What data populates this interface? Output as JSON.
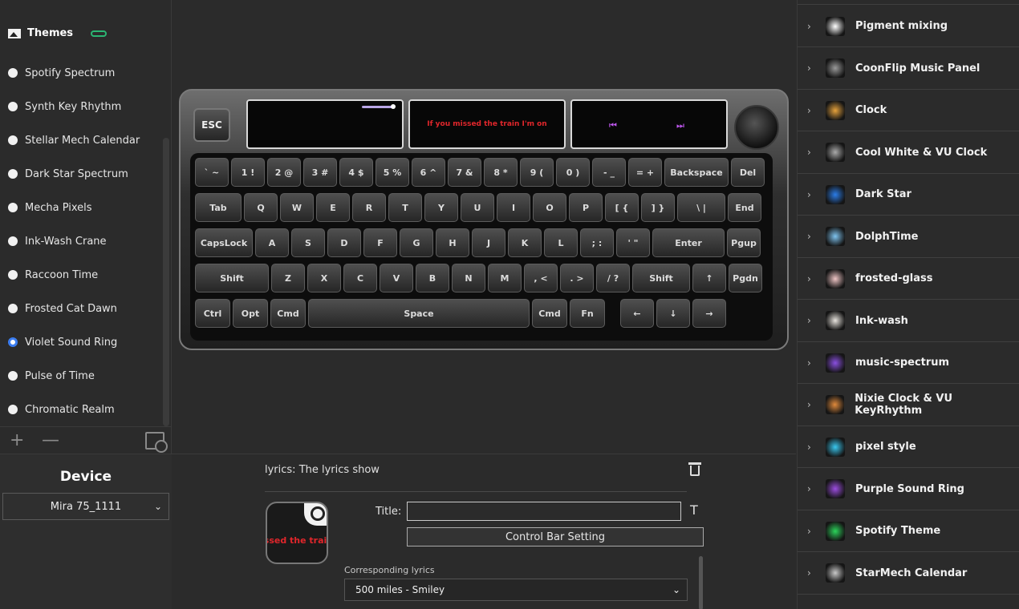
{
  "themes": {
    "title": "Themes",
    "items": [
      {
        "label": "Spotify Spectrum",
        "selected": false
      },
      {
        "label": "Synth Key Rhythm",
        "selected": false
      },
      {
        "label": "Stellar Mech Calendar",
        "selected": false
      },
      {
        "label": "Dark Star Spectrum",
        "selected": false
      },
      {
        "label": "Mecha Pixels",
        "selected": false
      },
      {
        "label": "Ink-Wash Crane",
        "selected": false
      },
      {
        "label": "Raccoon Time",
        "selected": false
      },
      {
        "label": "Frosted Cat Dawn",
        "selected": false
      },
      {
        "label": "Violet Sound Ring",
        "selected": true
      },
      {
        "label": "Pulse of Time",
        "selected": false
      },
      {
        "label": "Chromatic Realm",
        "selected": false
      }
    ],
    "add_label": "+",
    "remove_label": "—"
  },
  "device": {
    "title": "Device",
    "selected": "Mira 75_1111"
  },
  "keyboard": {
    "esc": "ESC",
    "screen_lyric": "If you missed the train I'm on",
    "prev_glyph": "⏮",
    "next_glyph": "⏭",
    "rows": [
      [
        "` ~",
        "1 !",
        "2 @",
        "3 #",
        "4 $",
        "5 %",
        "6 ^",
        "7 &",
        "8 *",
        "9 (",
        "0 )",
        "- _",
        "= +",
        "Backspace",
        "Del"
      ],
      [
        "Tab",
        "Q",
        "W",
        "E",
        "R",
        "T",
        "Y",
        "U",
        "I",
        "O",
        "P",
        "[ {",
        "] }",
        "\\ |",
        "End"
      ],
      [
        "CapsLock",
        "A",
        "S",
        "D",
        "F",
        "G",
        "H",
        "J",
        "K",
        "L",
        "; :",
        "' \"",
        "Enter",
        "Pgup"
      ],
      [
        "Shift",
        "Z",
        "X",
        "C",
        "V",
        "B",
        "N",
        "M",
        ", <",
        ". >",
        "/ ?",
        "Shift",
        "↑",
        "Pgdn"
      ],
      [
        "Ctrl",
        "Opt",
        "Cmd",
        "Space",
        "Cmd",
        "Fn",
        "←",
        "↓",
        "→"
      ]
    ]
  },
  "lyrics_panel": {
    "caption": "lyrics: The lyrics show",
    "preview_text": "issed the trai",
    "title_label": "Title:",
    "title_value": "",
    "text_tool": "T",
    "control_bar_label": "Control Bar Setting",
    "corresponding_label": "Corresponding lyrics",
    "song_selected": "500 miles - Smiley"
  },
  "right_panel": {
    "items": [
      {
        "label": "Pigment mixing",
        "icon": "palette-icon",
        "color": "#ffffff"
      },
      {
        "label": "CoonFlip Music Panel",
        "icon": "raccoon-icon",
        "color": "#9a9a9a"
      },
      {
        "label": "Clock",
        "icon": "clock-icon",
        "color": "#e6a23c"
      },
      {
        "label": "Cool White & VU Clock",
        "icon": "vu-clock-icon",
        "color": "#aaaaaa"
      },
      {
        "label": "Dark Star",
        "icon": "dark-star-icon",
        "color": "#2b7de9"
      },
      {
        "label": "DolphTime",
        "icon": "dolphin-icon",
        "color": "#7fc4f0"
      },
      {
        "label": "frosted-glass",
        "icon": "frosted-glass-icon",
        "color": "#f0c6c6"
      },
      {
        "label": "Ink-wash",
        "icon": "ink-wash-icon",
        "color": "#e8e4de"
      },
      {
        "label": "music-spectrum",
        "icon": "music-spectrum-icon",
        "color": "#8a4fe0"
      },
      {
        "label": "Nixie Clock & VU KeyRhythm",
        "icon": "nixie-icon",
        "color": "#e08a3c"
      },
      {
        "label": "pixel style",
        "icon": "pixel-icon",
        "color": "#39c8f0"
      },
      {
        "label": "Purple Sound Ring",
        "icon": "purple-ring-icon",
        "color": "#9c4de0"
      },
      {
        "label": "Spotify Theme",
        "icon": "spotify-icon",
        "color": "#2bd45a"
      },
      {
        "label": "StarMech Calendar",
        "icon": "starmech-icon",
        "color": "#c8c8c8"
      }
    ]
  }
}
